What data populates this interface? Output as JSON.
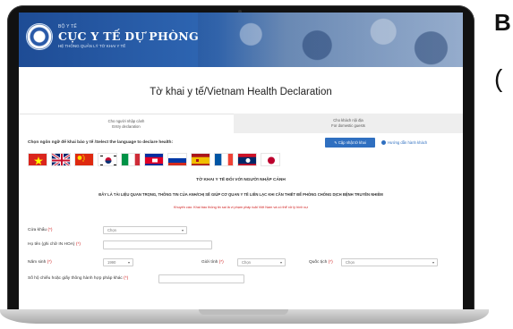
{
  "header": {
    "small_text": "BỘ Y TẾ",
    "org_name": "CỤC Y TẾ DỰ PHÒNG",
    "subtitle": "HỆ THỐNG QUẢN LÝ TỜ KHAI Y TẾ"
  },
  "page_title": "Tờ khai y tế/Vietnam Health Declaration",
  "tabs": [
    {
      "line1": "Cho người nhập cảnh",
      "line2": "Entry declaration"
    },
    {
      "line1": "Cho khách nội địa",
      "line2": "For domestic guests"
    }
  ],
  "language_prompt": "Chọn ngôn ngữ để khai báo y tế /Select the language to declare health:",
  "update_button": "Cập nhật tờ khai",
  "guide_link": "Hướng dẫn hành khách",
  "flags": [
    "vietnam-flag-icon",
    "uk-flag-icon",
    "china-flag-icon",
    "korea-flag-icon",
    "italy-flag-icon",
    "cambodia-flag-icon",
    "russia-flag-icon",
    "spain-flag-icon",
    "france-flag-icon",
    "laos-flag-icon",
    "japan-flag-icon"
  ],
  "form": {
    "heading": "TỜ KHAI Y TẾ ĐỐI VỚI NGƯỜI NHẬP CẢNH",
    "notice": "ĐÂY LÀ TÀI LIỆU QUAN TRỌNG, THÔNG TIN CỦA ANH/CHỊ SẼ GIÚP CƠ QUAN Y TẾ LIÊN LẠC KHI CẦN THIẾT ĐỂ PHÒNG CHỐNG DỊCH BỆNH TRUYỀN NHIỄM",
    "warning": "Khuyến cáo: Khai báo thông tin sai là vi phạm pháp luật Việt Nam và có thể xử lý hình sự",
    "border_gate_label": "Cửa khẩu",
    "border_gate_value": "Chọn",
    "full_name_label": "Họ tên (ghi chữ IN HOA)",
    "birth_year_label": "Năm sinh",
    "birth_year_value": "1990",
    "gender_label": "Giới tính",
    "gender_value": "Chọn",
    "nationality_label": "Quốc tịch",
    "nationality_value": "Chọn",
    "passport_label": "Số hộ chiếu hoặc giấy thông hành hợp pháp khác"
  },
  "side_text": {
    "line1": "B",
    "line2": "("
  }
}
